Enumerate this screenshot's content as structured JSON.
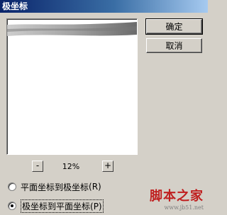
{
  "window": {
    "title": "极坐标"
  },
  "buttons": {
    "ok": "确定",
    "cancel": "取消"
  },
  "zoom": {
    "minus": "-",
    "value": "12%",
    "plus": "+"
  },
  "options": [
    {
      "label": "平面坐标到极坐标",
      "shortcut": "(R)",
      "checked": false
    },
    {
      "label": "极坐标到平面坐标",
      "shortcut": "(P)",
      "checked": true
    }
  ],
  "watermark": {
    "main": "脚本之家",
    "url": "www.jb51.net"
  }
}
